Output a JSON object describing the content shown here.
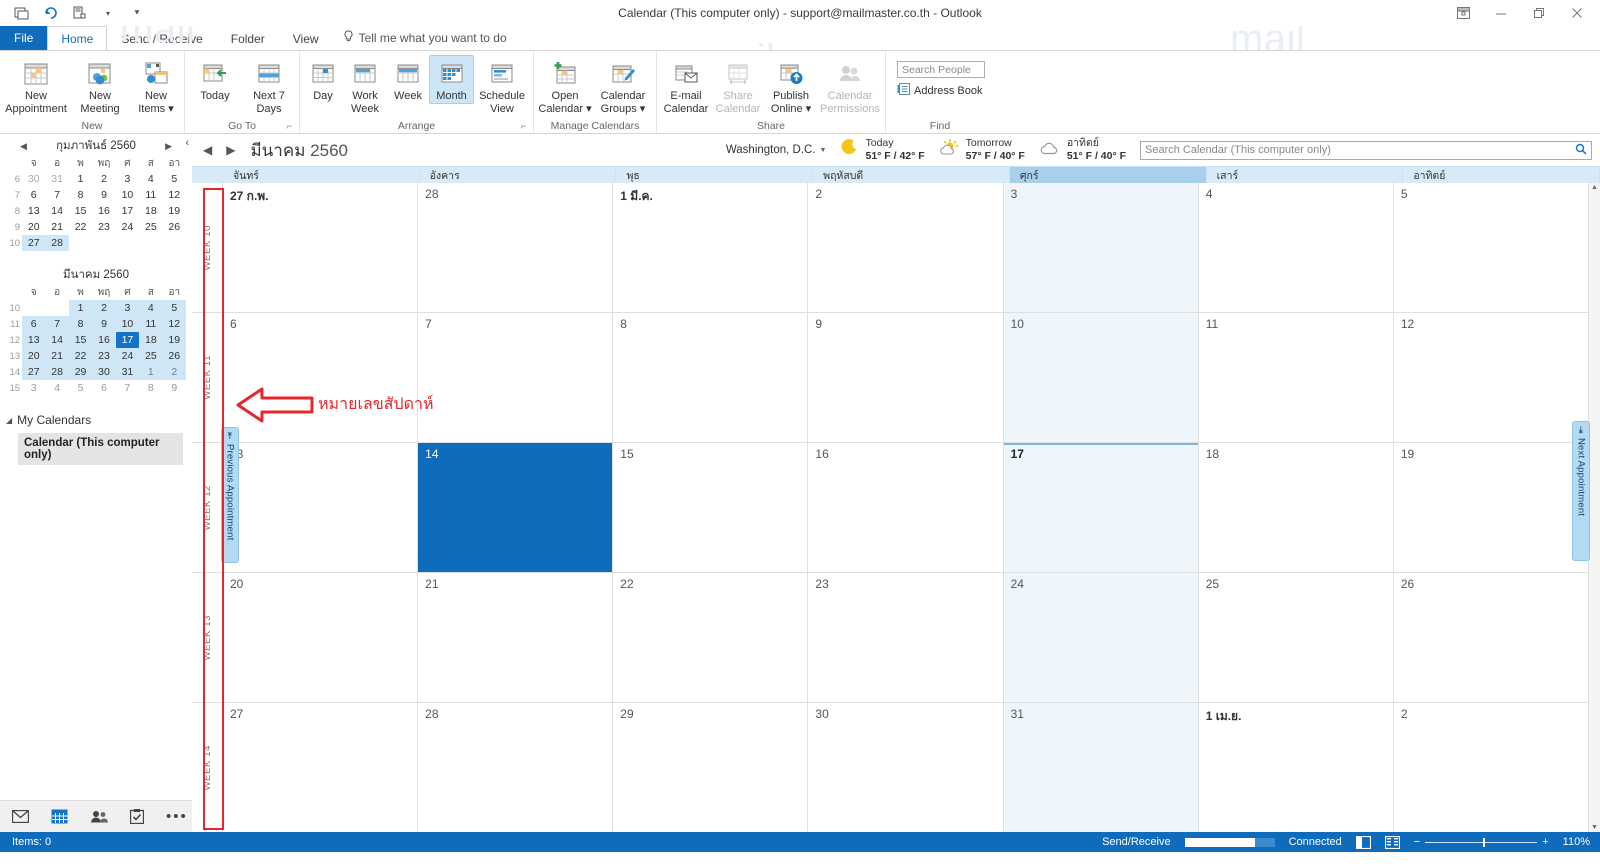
{
  "window": {
    "title": "Calendar (This computer only) - support@mailmaster.co.th  -  Outlook",
    "qat": [
      {
        "name": "quick-access-send-receive",
        "label": "Send/Receive All Folders"
      },
      {
        "name": "undo",
        "label": "Undo"
      },
      {
        "name": "quick-print",
        "label": "Print"
      },
      {
        "name": "customize-qat",
        "label": "Customize Quick Access Toolbar"
      }
    ],
    "controls": [
      {
        "name": "ribbon-display-options",
        "label": "Ribbon Display Options"
      },
      {
        "name": "minimize",
        "label": "Minimize"
      },
      {
        "name": "restore",
        "label": "Restore Down"
      },
      {
        "name": "close",
        "label": "Close"
      }
    ]
  },
  "tabs": {
    "file": "File",
    "items": [
      "Home",
      "Send / Receive",
      "Folder",
      "View"
    ],
    "active": "Home",
    "tellme": "Tell me what you want to do"
  },
  "ribbon": {
    "groups": [
      {
        "name": "New",
        "label": "New",
        "buttons": [
          {
            "label1": "New",
            "label2": "Appointment",
            "icon": "new-appointment-icon",
            "state": "normal"
          },
          {
            "label1": "New",
            "label2": "Meeting",
            "icon": "new-meeting-icon",
            "state": "normal"
          },
          {
            "label1": "New",
            "label2": "Items ▾",
            "icon": "new-items-icon",
            "state": "normal"
          }
        ]
      },
      {
        "name": "Go To",
        "label": "Go To",
        "dialog": true,
        "buttons": [
          {
            "label1": "Today",
            "label2": "",
            "icon": "today-icon",
            "state": "normal"
          },
          {
            "label1": "Next 7",
            "label2": "Days",
            "icon": "next-7-days-icon",
            "state": "normal"
          }
        ]
      },
      {
        "name": "Arrange",
        "label": "Arrange",
        "dialog": true,
        "buttons": [
          {
            "label1": "Day",
            "label2": "",
            "icon": "day-view-icon",
            "state": "normal"
          },
          {
            "label1": "Work",
            "label2": "Week",
            "icon": "work-week-icon",
            "state": "normal"
          },
          {
            "label1": "Week",
            "label2": "",
            "icon": "week-view-icon",
            "state": "normal"
          },
          {
            "label1": "Month",
            "label2": "",
            "icon": "month-view-icon",
            "state": "selected"
          },
          {
            "label1": "Schedule",
            "label2": "View",
            "icon": "schedule-view-icon",
            "state": "normal"
          }
        ]
      },
      {
        "name": "Manage Calendars",
        "label": "Manage Calendars",
        "buttons": [
          {
            "label1": "Open",
            "label2": "Calendar ▾",
            "icon": "open-calendar-icon",
            "state": "normal"
          },
          {
            "label1": "Calendar",
            "label2": "Groups ▾",
            "icon": "calendar-groups-icon",
            "state": "normal"
          }
        ]
      },
      {
        "name": "Share",
        "label": "Share",
        "buttons": [
          {
            "label1": "E-mail",
            "label2": "Calendar",
            "icon": "email-calendar-icon",
            "state": "normal"
          },
          {
            "label1": "Share",
            "label2": "Calendar",
            "icon": "share-calendar-icon",
            "state": "disabled"
          },
          {
            "label1": "Publish",
            "label2": "Online ▾",
            "icon": "publish-online-icon",
            "state": "normal"
          },
          {
            "label1": "Calendar",
            "label2": "Permissions",
            "icon": "calendar-permissions-icon",
            "state": "disabled"
          }
        ]
      },
      {
        "name": "Find",
        "label": "Find",
        "search_people_placeholder": "Search People",
        "address_book_label": "Address Book"
      }
    ]
  },
  "navpane": {
    "minicalendars": [
      {
        "month_label": "กุมภาพันธ์ 2560",
        "has_arrows": true,
        "dow": [
          "จ",
          "อ",
          "พ",
          "พฤ",
          "ศ",
          "ส",
          "อา"
        ],
        "weeks": [
          {
            "wk": "6",
            "days": [
              {
                "d": "30",
                "st": "other"
              },
              {
                "d": "31",
                "st": "other"
              },
              {
                "d": "1",
                "st": "normal"
              },
              {
                "d": "2",
                "st": "normal"
              },
              {
                "d": "3",
                "st": "normal"
              },
              {
                "d": "4",
                "st": "normal"
              },
              {
                "d": "5",
                "st": "normal"
              }
            ]
          },
          {
            "wk": "7",
            "days": [
              {
                "d": "6",
                "st": "normal"
              },
              {
                "d": "7",
                "st": "normal"
              },
              {
                "d": "8",
                "st": "normal"
              },
              {
                "d": "9",
                "st": "normal"
              },
              {
                "d": "10",
                "st": "normal"
              },
              {
                "d": "11",
                "st": "normal"
              },
              {
                "d": "12",
                "st": "normal"
              }
            ]
          },
          {
            "wk": "8",
            "days": [
              {
                "d": "13",
                "st": "normal"
              },
              {
                "d": "14",
                "st": "normal"
              },
              {
                "d": "15",
                "st": "normal"
              },
              {
                "d": "16",
                "st": "normal"
              },
              {
                "d": "17",
                "st": "normal"
              },
              {
                "d": "18",
                "st": "normal"
              },
              {
                "d": "19",
                "st": "normal"
              }
            ]
          },
          {
            "wk": "9",
            "days": [
              {
                "d": "20",
                "st": "normal"
              },
              {
                "d": "21",
                "st": "normal"
              },
              {
                "d": "22",
                "st": "normal"
              },
              {
                "d": "23",
                "st": "normal"
              },
              {
                "d": "24",
                "st": "normal"
              },
              {
                "d": "25",
                "st": "normal"
              },
              {
                "d": "26",
                "st": "normal"
              }
            ]
          },
          {
            "wk": "10",
            "days": [
              {
                "d": "27",
                "st": "sel"
              },
              {
                "d": "28",
                "st": "sel"
              },
              {
                "d": "",
                "st": "empty"
              },
              {
                "d": "",
                "st": "empty"
              },
              {
                "d": "",
                "st": "empty"
              },
              {
                "d": "",
                "st": "empty"
              },
              {
                "d": "",
                "st": "empty"
              }
            ]
          }
        ]
      },
      {
        "month_label": "มีนาคม 2560",
        "has_arrows": false,
        "dow": [
          "จ",
          "อ",
          "พ",
          "พฤ",
          "ศ",
          "ส",
          "อา"
        ],
        "weeks": [
          {
            "wk": "10",
            "days": [
              {
                "d": "",
                "st": "empty"
              },
              {
                "d": "",
                "st": "empty"
              },
              {
                "d": "1",
                "st": "sel"
              },
              {
                "d": "2",
                "st": "sel"
              },
              {
                "d": "3",
                "st": "sel"
              },
              {
                "d": "4",
                "st": "sel"
              },
              {
                "d": "5",
                "st": "sel"
              }
            ]
          },
          {
            "wk": "11",
            "days": [
              {
                "d": "6",
                "st": "sel"
              },
              {
                "d": "7",
                "st": "sel"
              },
              {
                "d": "8",
                "st": "sel"
              },
              {
                "d": "9",
                "st": "sel"
              },
              {
                "d": "10",
                "st": "sel"
              },
              {
                "d": "11",
                "st": "sel"
              },
              {
                "d": "12",
                "st": "sel"
              }
            ]
          },
          {
            "wk": "12",
            "days": [
              {
                "d": "13",
                "st": "sel"
              },
              {
                "d": "14",
                "st": "sel"
              },
              {
                "d": "15",
                "st": "sel"
              },
              {
                "d": "16",
                "st": "sel"
              },
              {
                "d": "17",
                "st": "today"
              },
              {
                "d": "18",
                "st": "sel"
              },
              {
                "d": "19",
                "st": "sel"
              }
            ]
          },
          {
            "wk": "13",
            "days": [
              {
                "d": "20",
                "st": "sel"
              },
              {
                "d": "21",
                "st": "sel"
              },
              {
                "d": "22",
                "st": "sel"
              },
              {
                "d": "23",
                "st": "sel"
              },
              {
                "d": "24",
                "st": "sel"
              },
              {
                "d": "25",
                "st": "sel"
              },
              {
                "d": "26",
                "st": "sel"
              }
            ]
          },
          {
            "wk": "14",
            "days": [
              {
                "d": "27",
                "st": "sel"
              },
              {
                "d": "28",
                "st": "sel"
              },
              {
                "d": "29",
                "st": "sel"
              },
              {
                "d": "30",
                "st": "sel"
              },
              {
                "d": "31",
                "st": "sel"
              },
              {
                "d": "1",
                "st": "sel"
              },
              {
                "d": "2",
                "st": "sel"
              }
            ]
          },
          {
            "wk": "15",
            "days": [
              {
                "d": "3",
                "st": "normal"
              },
              {
                "d": "4",
                "st": "normal"
              },
              {
                "d": "5",
                "st": "normal"
              },
              {
                "d": "6",
                "st": "normal"
              },
              {
                "d": "7",
                "st": "normal"
              },
              {
                "d": "8",
                "st": "normal"
              },
              {
                "d": "9",
                "st": "normal"
              }
            ]
          }
        ]
      }
    ],
    "my_calendars_label": "My Calendars",
    "calendar_item": "Calendar (This computer only)",
    "bottom_nav": [
      {
        "name": "nav-mail",
        "glyph": "mail-icon",
        "active": false
      },
      {
        "name": "nav-calendar",
        "glyph": "calendar-icon",
        "active": true
      },
      {
        "name": "nav-people",
        "glyph": "people-icon",
        "active": false
      },
      {
        "name": "nav-tasks",
        "glyph": "tasks-icon",
        "active": false
      },
      {
        "name": "nav-more",
        "glyph": "more-icon",
        "active": false
      }
    ]
  },
  "calendar": {
    "title_month": "มีนาคม",
    "title_year": "2560",
    "location": "Washington,  D.C.",
    "weather": [
      {
        "icon": "moon-icon",
        "label": "Today",
        "temps": "51° F / 42° F"
      },
      {
        "icon": "sun-cloud-icon",
        "label": "Tomorrow",
        "temps": "57° F / 40° F"
      },
      {
        "icon": "cloud-icon",
        "label": "อาทิตย์",
        "temps": "51° F / 40° F"
      }
    ],
    "search_placeholder": "Search Calendar (This computer only)",
    "day_headers": [
      {
        "label": "จันทร์",
        "highlight": false
      },
      {
        "label": "อังคาร",
        "highlight": false
      },
      {
        "label": "พุธ",
        "highlight": false
      },
      {
        "label": "พฤหัสบดี",
        "highlight": false
      },
      {
        "label": "ศุกร์",
        "highlight": true
      },
      {
        "label": "เสาร์",
        "highlight": false
      },
      {
        "label": "อาทิตย์",
        "highlight": false
      }
    ],
    "week_labels": [
      "WEEK 10",
      "WEEK 11",
      "WEEK 12",
      "WEEK 13",
      "WEEK 14"
    ],
    "rows": [
      [
        {
          "num": "27 ก.พ.",
          "state": "monthfirst"
        },
        {
          "num": "28",
          "state": "normal"
        },
        {
          "num": "1 มี.ค.",
          "state": "monthfirst"
        },
        {
          "num": "2",
          "state": "normal"
        },
        {
          "num": "3",
          "state": "todaycol"
        },
        {
          "num": "4",
          "state": "normal"
        },
        {
          "num": "5",
          "state": "normal"
        }
      ],
      [
        {
          "num": "6",
          "state": "normal"
        },
        {
          "num": "7",
          "state": "normal"
        },
        {
          "num": "8",
          "state": "normal"
        },
        {
          "num": "9",
          "state": "normal"
        },
        {
          "num": "10",
          "state": "todaycol"
        },
        {
          "num": "11",
          "state": "normal"
        },
        {
          "num": "12",
          "state": "normal"
        }
      ],
      [
        {
          "num": "13",
          "state": "normal"
        },
        {
          "num": "14",
          "state": "selected"
        },
        {
          "num": "15",
          "state": "normal"
        },
        {
          "num": "16",
          "state": "normal"
        },
        {
          "num": "17",
          "state": "today"
        },
        {
          "num": "18",
          "state": "normal"
        },
        {
          "num": "19",
          "state": "normal"
        }
      ],
      [
        {
          "num": "20",
          "state": "normal"
        },
        {
          "num": "21",
          "state": "normal"
        },
        {
          "num": "22",
          "state": "normal"
        },
        {
          "num": "23",
          "state": "normal"
        },
        {
          "num": "24",
          "state": "todaycol"
        },
        {
          "num": "25",
          "state": "normal"
        },
        {
          "num": "26",
          "state": "normal"
        }
      ],
      [
        {
          "num": "27",
          "state": "normal"
        },
        {
          "num": "28",
          "state": "normal"
        },
        {
          "num": "29",
          "state": "normal"
        },
        {
          "num": "30",
          "state": "normal"
        },
        {
          "num": "31",
          "state": "todaycol"
        },
        {
          "num": "1 เม.ย.",
          "state": "monthfirst"
        },
        {
          "num": "2",
          "state": "normal"
        }
      ]
    ],
    "prev_appointment_label": "Previous Appointment",
    "next_appointment_label": "Next Appointment"
  },
  "annotation": {
    "text": "หมายเลขสัปดาห์",
    "color": "#e8262a"
  },
  "statusbar": {
    "items": "Items: 0",
    "send_receive": "Send/Receive",
    "connected": "Connected",
    "zoom": "110%"
  },
  "colors": {
    "accent": "#0f6cbd",
    "selection": "#0f6cbd",
    "header_band": "#d9eaf7",
    "annotation_red": "#e8262a"
  }
}
